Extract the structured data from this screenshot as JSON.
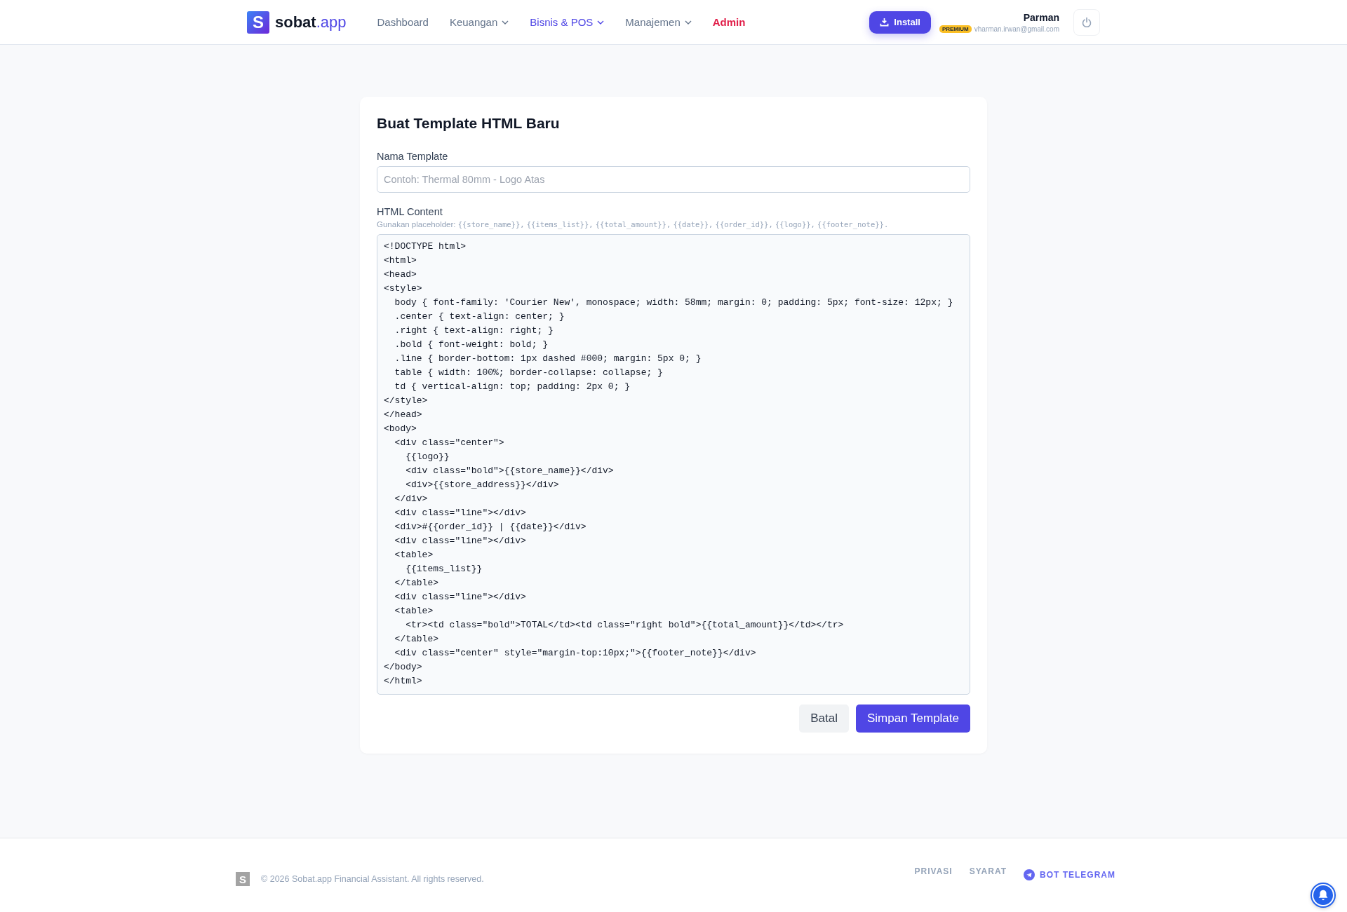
{
  "brand": {
    "mark": "S",
    "name": "sobat",
    "tld": ".app"
  },
  "nav": [
    {
      "label": "Dashboard",
      "kind": "plain",
      "dropdown": false,
      "selected": false
    },
    {
      "label": "Keuangan",
      "kind": "plain",
      "dropdown": true,
      "selected": false
    },
    {
      "label": "Bisnis & POS",
      "kind": "plain",
      "dropdown": true,
      "selected": true
    },
    {
      "label": "Manajemen",
      "kind": "plain",
      "dropdown": true,
      "selected": false
    },
    {
      "label": "Admin",
      "kind": "admin",
      "dropdown": false,
      "selected": false
    }
  ],
  "install_button": "Install",
  "user": {
    "name": "Parman",
    "badge": "PREMIUM",
    "email": "vharman.irwan@gmail.com"
  },
  "form": {
    "title": "Buat Template HTML Baru",
    "name_label": "Nama Template",
    "name_placeholder": "Contoh: Thermal 80mm - Logo Atas",
    "content_label": "HTML Content",
    "hint": {
      "lead": "Gunakan placeholder:",
      "tokens": [
        "{{store_name}},",
        "{{items_list}},",
        "{{total_amount}},",
        "{{date}},",
        "{{order_id}},",
        "{{logo}},",
        "{{footer_note}}."
      ]
    },
    "content": "<!DOCTYPE html>\n<html>\n<head>\n<style>\n  body { font-family: 'Courier New', monospace; width: 58mm; margin: 0; padding: 5px; font-size: 12px; }\n  .center { text-align: center; }\n  .right { text-align: right; }\n  .bold { font-weight: bold; }\n  .line { border-bottom: 1px dashed #000; margin: 5px 0; }\n  table { width: 100%; border-collapse: collapse; }\n  td { vertical-align: top; padding: 2px 0; }\n</style>\n</head>\n<body>\n  <div class=\"center\">\n    {{logo}}\n    <div class=\"bold\">{{store_name}}</div>\n    <div>{{store_address}}</div>\n  </div>\n  <div class=\"line\"></div>\n  <div>#{{order_id}} | {{date}}</div>\n  <div class=\"line\"></div>\n  <table>\n    {{items_list}}\n  </table>\n  <div class=\"line\"></div>\n  <table>\n    <tr><td class=\"bold\">TOTAL</td><td class=\"right bold\">{{total_amount}}</td></tr>\n  </table>\n  <div class=\"center\" style=\"margin-top:10px;\">{{footer_note}}</div>\n</body>\n</html>",
    "cancel_button": "Batal",
    "save_button": "Simpan Template"
  },
  "footer": {
    "mark": "S",
    "copyright": "© 2026 Sobat.app Financial Assistant. All rights reserved.",
    "links": [
      {
        "label": "PRIVASI",
        "kind": "plain"
      },
      {
        "label": "SYARAT",
        "kind": "plain"
      },
      {
        "label": "BOT TELEGRAM",
        "kind": "telegram"
      }
    ]
  }
}
